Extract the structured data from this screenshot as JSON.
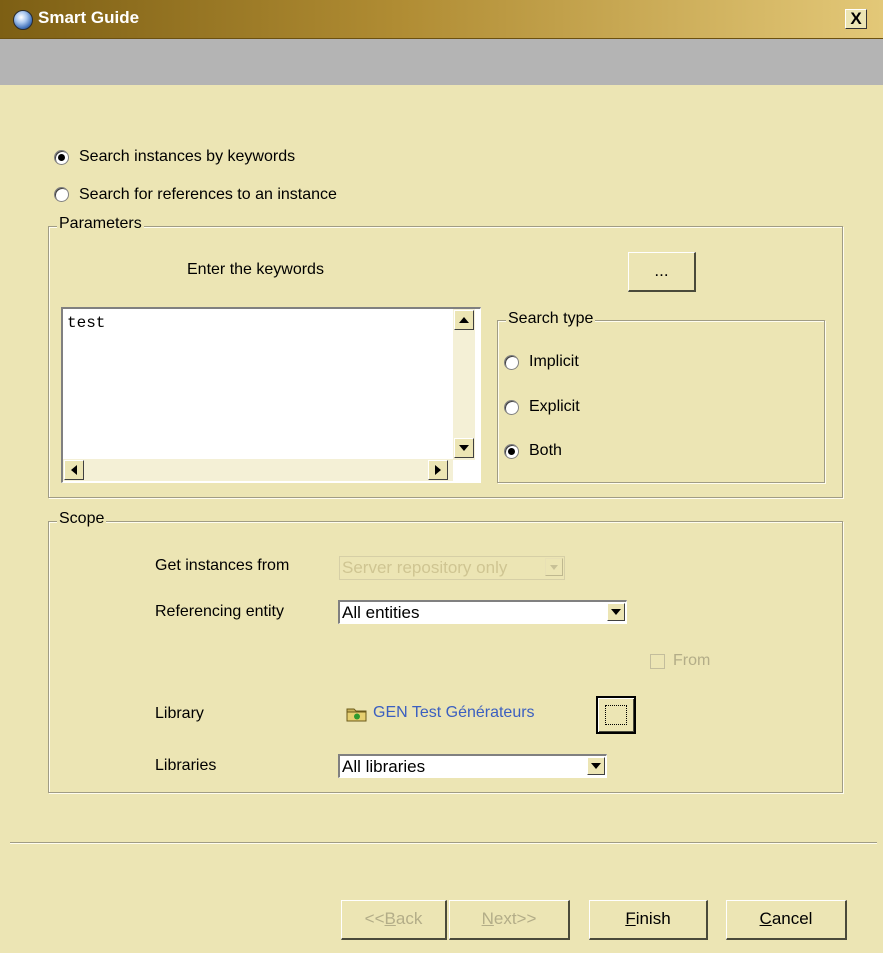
{
  "window": {
    "title": "Smart Guide",
    "close_label": "X"
  },
  "search_mode": {
    "option_keywords": "Search instances by keywords",
    "option_references": "Search for references to an instance",
    "selected": "keywords"
  },
  "parameters": {
    "legend": "Parameters",
    "keywords_label": "Enter the keywords",
    "browse_label": "...",
    "keywords_value": "test",
    "search_type": {
      "legend": "Search type",
      "implicit": "Implicit",
      "explicit": "Explicit",
      "both": "Both",
      "selected": "both"
    }
  },
  "scope": {
    "legend": "Scope",
    "get_instances_label": "Get instances from",
    "get_instances_value": "Server repository only",
    "referencing_label": "Referencing entity",
    "referencing_value": "All entities",
    "from_label": "From",
    "library_label": "Library",
    "library_value": "GEN Test Générateurs",
    "libraries_label": "Libraries",
    "libraries_value": "All libraries"
  },
  "buttons": {
    "back": {
      "prefix": "<<",
      "mnemonic": "B",
      "rest": "ack"
    },
    "next": {
      "mnemonic": "N",
      "rest": "ext>>"
    },
    "finish": {
      "mnemonic": "F",
      "rest": "inish"
    },
    "cancel": {
      "mnemonic": "C",
      "rest": "ancel"
    }
  },
  "colors": {
    "background": "#ece5b4",
    "title_gradient_start": "#7d5f14",
    "title_gradient_end": "#e3c878",
    "link_blue": "#3b5fc0"
  }
}
